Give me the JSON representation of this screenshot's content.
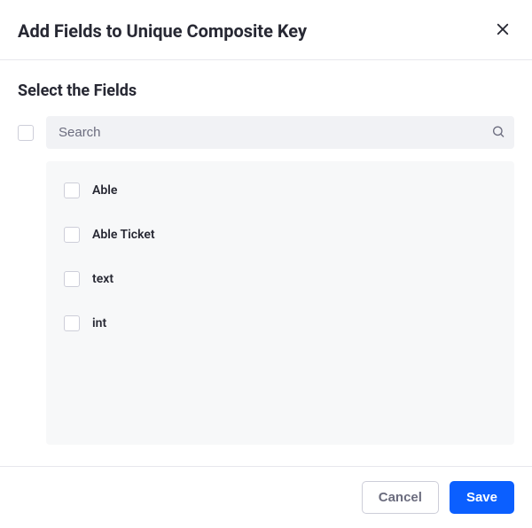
{
  "dialog": {
    "title": "Add Fields to Unique Composite Key",
    "section_title": "Select the Fields",
    "search": {
      "placeholder": "Search",
      "value": ""
    },
    "fields": [
      {
        "label": "Able",
        "checked": false
      },
      {
        "label": "Able Ticket",
        "checked": false
      },
      {
        "label": "text",
        "checked": false
      },
      {
        "label": "int",
        "checked": false
      }
    ],
    "footer": {
      "cancel_label": "Cancel",
      "save_label": "Save"
    }
  }
}
